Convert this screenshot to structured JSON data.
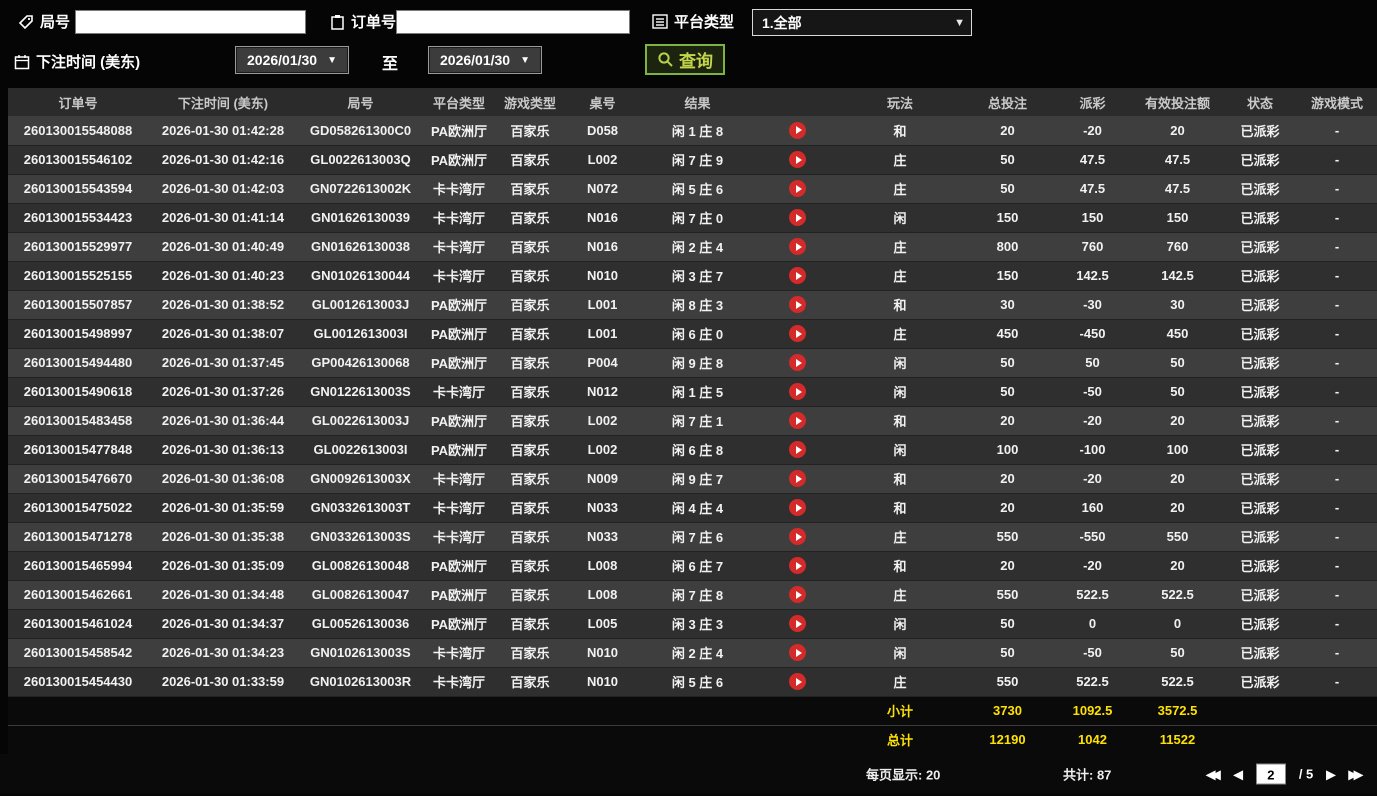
{
  "filters": {
    "round_label": "局号",
    "round_value": "",
    "order_label": "订单号",
    "order_value": "",
    "platform_label": "平台类型",
    "platform_selected": "1.全部",
    "bet_time_label": "下注时间 (美东)",
    "date_from": "2026/01/30",
    "to_label": "至",
    "date_to": "2026/01/30",
    "search_button": "查询"
  },
  "icons": {
    "dropdown_arrow": "▼",
    "first_page": "◀◀",
    "prev_page": "◀",
    "next_page": "▶",
    "last_page": "▶▶"
  },
  "colors": {
    "payout_positive": "#b23b3b",
    "payout_negative": "#3ecc3e",
    "status_green": "#3ecc3e",
    "summary_yellow": "#ffe100",
    "play_button_red": "#d42a2a",
    "search_border_green": "#7cb342"
  },
  "table": {
    "headers": [
      "订单号",
      "下注时间 (美东)",
      "局号",
      "平台类型",
      "游戏类型",
      "桌号",
      "结果",
      "",
      "玩法",
      "总投注",
      "派彩",
      "有效投注额",
      "状态",
      "游戏模式"
    ],
    "rows": [
      {
        "order": "260130015548088",
        "time": "2026-01-30 01:42:28",
        "round": "GD058261300C0",
        "platform": "PA欧洲厅",
        "game": "百家乐",
        "table_no": "D058",
        "result": "闲 1 庄 8",
        "play": "和",
        "bet": "20",
        "payout": "-20",
        "valid": "20",
        "status": "已派彩",
        "mode": "-"
      },
      {
        "order": "260130015546102",
        "time": "2026-01-30 01:42:16",
        "round": "GL0022613003Q",
        "platform": "PA欧洲厅",
        "game": "百家乐",
        "table_no": "L002",
        "result": "闲 7 庄 9",
        "play": "庄",
        "bet": "50",
        "payout": "47.5",
        "valid": "47.5",
        "status": "已派彩",
        "mode": "-"
      },
      {
        "order": "260130015543594",
        "time": "2026-01-30 01:42:03",
        "round": "GN0722613002K",
        "platform": "卡卡湾厅",
        "game": "百家乐",
        "table_no": "N072",
        "result": "闲 5 庄 6",
        "play": "庄",
        "bet": "50",
        "payout": "47.5",
        "valid": "47.5",
        "status": "已派彩",
        "mode": "-"
      },
      {
        "order": "260130015534423",
        "time": "2026-01-30 01:41:14",
        "round": "GN01626130039",
        "platform": "卡卡湾厅",
        "game": "百家乐",
        "table_no": "N016",
        "result": "闲 7 庄 0",
        "play": "闲",
        "bet": "150",
        "payout": "150",
        "valid": "150",
        "status": "已派彩",
        "mode": "-"
      },
      {
        "order": "260130015529977",
        "time": "2026-01-30 01:40:49",
        "round": "GN01626130038",
        "platform": "卡卡湾厅",
        "game": "百家乐",
        "table_no": "N016",
        "result": "闲 2 庄 4",
        "play": "庄",
        "bet": "800",
        "payout": "760",
        "valid": "760",
        "status": "已派彩",
        "mode": "-"
      },
      {
        "order": "260130015525155",
        "time": "2026-01-30 01:40:23",
        "round": "GN01026130044",
        "platform": "卡卡湾厅",
        "game": "百家乐",
        "table_no": "N010",
        "result": "闲 3 庄 7",
        "play": "庄",
        "bet": "150",
        "payout": "142.5",
        "valid": "142.5",
        "status": "已派彩",
        "mode": "-"
      },
      {
        "order": "260130015507857",
        "time": "2026-01-30 01:38:52",
        "round": "GL0012613003J",
        "platform": "PA欧洲厅",
        "game": "百家乐",
        "table_no": "L001",
        "result": "闲 8 庄 3",
        "play": "和",
        "bet": "30",
        "payout": "-30",
        "valid": "30",
        "status": "已派彩",
        "mode": "-"
      },
      {
        "order": "260130015498997",
        "time": "2026-01-30 01:38:07",
        "round": "GL0012613003I",
        "platform": "PA欧洲厅",
        "game": "百家乐",
        "table_no": "L001",
        "result": "闲 6 庄 0",
        "play": "庄",
        "bet": "450",
        "payout": "-450",
        "valid": "450",
        "status": "已派彩",
        "mode": "-"
      },
      {
        "order": "260130015494480",
        "time": "2026-01-30 01:37:45",
        "round": "GP00426130068",
        "platform": "PA欧洲厅",
        "game": "百家乐",
        "table_no": "P004",
        "result": "闲 9 庄 8",
        "play": "闲",
        "bet": "50",
        "payout": "50",
        "valid": "50",
        "status": "已派彩",
        "mode": "-"
      },
      {
        "order": "260130015490618",
        "time": "2026-01-30 01:37:26",
        "round": "GN0122613003S",
        "platform": "卡卡湾厅",
        "game": "百家乐",
        "table_no": "N012",
        "result": "闲 1 庄 5",
        "play": "闲",
        "bet": "50",
        "payout": "-50",
        "valid": "50",
        "status": "已派彩",
        "mode": "-"
      },
      {
        "order": "260130015483458",
        "time": "2026-01-30 01:36:44",
        "round": "GL0022613003J",
        "platform": "PA欧洲厅",
        "game": "百家乐",
        "table_no": "L002",
        "result": "闲 7 庄 1",
        "play": "和",
        "bet": "20",
        "payout": "-20",
        "valid": "20",
        "status": "已派彩",
        "mode": "-"
      },
      {
        "order": "260130015477848",
        "time": "2026-01-30 01:36:13",
        "round": "GL0022613003I",
        "platform": "PA欧洲厅",
        "game": "百家乐",
        "table_no": "L002",
        "result": "闲 6 庄 8",
        "play": "闲",
        "bet": "100",
        "payout": "-100",
        "valid": "100",
        "status": "已派彩",
        "mode": "-"
      },
      {
        "order": "260130015476670",
        "time": "2026-01-30 01:36:08",
        "round": "GN0092613003X",
        "platform": "卡卡湾厅",
        "game": "百家乐",
        "table_no": "N009",
        "result": "闲 9 庄 7",
        "play": "和",
        "bet": "20",
        "payout": "-20",
        "valid": "20",
        "status": "已派彩",
        "mode": "-"
      },
      {
        "order": "260130015475022",
        "time": "2026-01-30 01:35:59",
        "round": "GN0332613003T",
        "platform": "卡卡湾厅",
        "game": "百家乐",
        "table_no": "N033",
        "result": "闲 4 庄 4",
        "play": "和",
        "bet": "20",
        "payout": "160",
        "valid": "20",
        "status": "已派彩",
        "mode": "-"
      },
      {
        "order": "260130015471278",
        "time": "2026-01-30 01:35:38",
        "round": "GN0332613003S",
        "platform": "卡卡湾厅",
        "game": "百家乐",
        "table_no": "N033",
        "result": "闲 7 庄 6",
        "play": "庄",
        "bet": "550",
        "payout": "-550",
        "valid": "550",
        "status": "已派彩",
        "mode": "-"
      },
      {
        "order": "260130015465994",
        "time": "2026-01-30 01:35:09",
        "round": "GL00826130048",
        "platform": "PA欧洲厅",
        "game": "百家乐",
        "table_no": "L008",
        "result": "闲 6 庄 7",
        "play": "和",
        "bet": "20",
        "payout": "-20",
        "valid": "20",
        "status": "已派彩",
        "mode": "-"
      },
      {
        "order": "260130015462661",
        "time": "2026-01-30 01:34:48",
        "round": "GL00826130047",
        "platform": "PA欧洲厅",
        "game": "百家乐",
        "table_no": "L008",
        "result": "闲 7 庄 8",
        "play": "庄",
        "bet": "550",
        "payout": "522.5",
        "valid": "522.5",
        "status": "已派彩",
        "mode": "-"
      },
      {
        "order": "260130015461024",
        "time": "2026-01-30 01:34:37",
        "round": "GL00526130036",
        "platform": "PA欧洲厅",
        "game": "百家乐",
        "table_no": "L005",
        "result": "闲 3 庄 3",
        "play": "闲",
        "bet": "50",
        "payout": "0",
        "valid": "0",
        "status": "已派彩",
        "mode": "-"
      },
      {
        "order": "260130015458542",
        "time": "2026-01-30 01:34:23",
        "round": "GN0102613003S",
        "platform": "卡卡湾厅",
        "game": "百家乐",
        "table_no": "N010",
        "result": "闲 2 庄 4",
        "play": "闲",
        "bet": "50",
        "payout": "-50",
        "valid": "50",
        "status": "已派彩",
        "mode": "-"
      },
      {
        "order": "260130015454430",
        "time": "2026-01-30 01:33:59",
        "round": "GN0102613003R",
        "platform": "卡卡湾厅",
        "game": "百家乐",
        "table_no": "N010",
        "result": "闲 5 庄 6",
        "play": "庄",
        "bet": "550",
        "payout": "522.5",
        "valid": "522.5",
        "status": "已派彩",
        "mode": "-"
      }
    ]
  },
  "summary": {
    "subtotal_label": "小计",
    "subtotal_bet": "3730",
    "subtotal_payout": "1092.5",
    "subtotal_valid": "3572.5",
    "total_label": "总计",
    "total_bet": "12190",
    "total_payout": "1042",
    "total_valid": "11522"
  },
  "pagination": {
    "per_page": "每页显示: 20",
    "total_count": "共计: 87",
    "current_page": "2",
    "total_pages_display": "/  5"
  }
}
